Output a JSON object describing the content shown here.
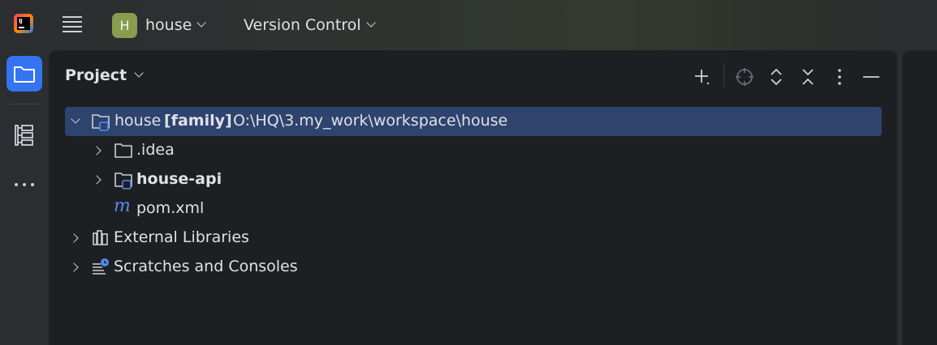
{
  "titlebar": {
    "project_letter": "H",
    "project_name": "house",
    "vcs_label": "Version Control"
  },
  "panel": {
    "title": "Project"
  },
  "tree": {
    "root": {
      "name": "house",
      "module_tag": "[family]",
      "path": "O:\\HQ\\3.my_work\\workspace\\house"
    },
    "idea": ".idea",
    "module": "house-api",
    "pom": "pom.xml",
    "pom_glyph": "m",
    "libraries": "External Libraries",
    "scratches": "Scratches and Consoles"
  },
  "colors": {
    "accent": "#3574f0",
    "selection": "#2e436e",
    "panel_bg": "#1e1f22",
    "project_badge": "#8a9c4f"
  }
}
